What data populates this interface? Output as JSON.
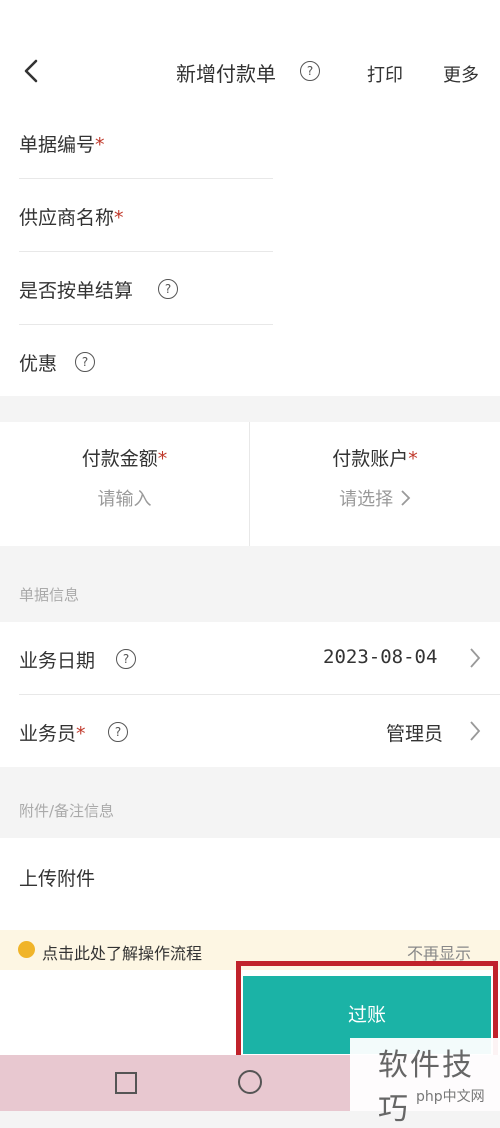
{
  "header": {
    "title": "新增付款单",
    "print_label": "打印",
    "more_label": "更多"
  },
  "form": {
    "doc_no_label": "单据编号",
    "supplier_label": "供应商名称",
    "settle_label": "是否按单结算",
    "discount_label": "优惠",
    "required_mark": "*"
  },
  "payment": {
    "amount_label": "付款金额",
    "amount_placeholder": "请输入",
    "account_label": "付款账户",
    "account_placeholder": "请选择"
  },
  "doc_info": {
    "section_title": "单据信息",
    "date_label": "业务日期",
    "date_value": "2023-08-04",
    "staff_label": "业务员",
    "staff_value": "管理员"
  },
  "attachment": {
    "section_title": "附件/备注信息",
    "upload_label": "上传附件"
  },
  "tip": {
    "text": "点击此处了解操作流程",
    "dismiss": "不再显示"
  },
  "post_button": "过账",
  "watermark": {
    "text": "软件技巧",
    "logo": "php中文网"
  },
  "colors": {
    "accent_teal": "#1bb3a6",
    "highlight_red": "#c0222b",
    "required_red": "#c0392b",
    "tip_bg": "#fdf6e3",
    "tip_icon": "#f0b429",
    "navbar_pink": "#e8c8d0"
  }
}
